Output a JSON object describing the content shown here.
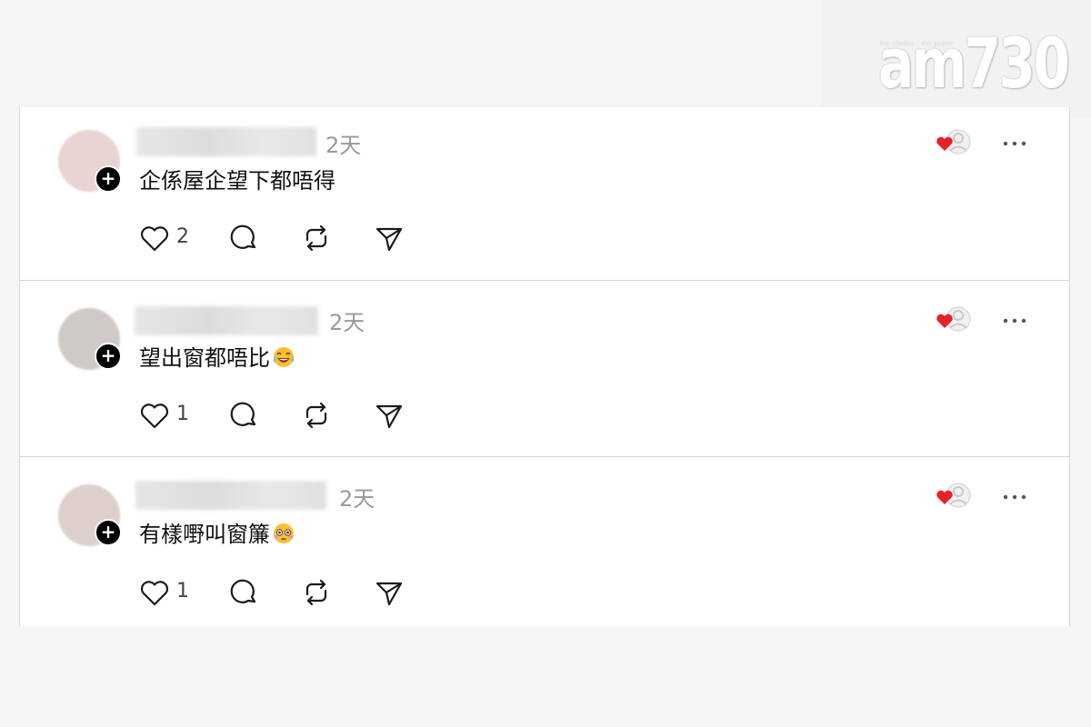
{
  "watermark": {
    "tagline": "my choice · my paper",
    "logo": "am730"
  },
  "posts": [
    {
      "time": "2天",
      "text": "企係屋企望下都唔得",
      "emoji": "",
      "likes": "2",
      "avatar_color": "#e9d3d3"
    },
    {
      "time": "2天",
      "text": "望出窗都唔比",
      "emoji": "laughing-tears-emoji",
      "likes": "1",
      "avatar_color": "#cfcac6"
    },
    {
      "time": "2天",
      "text": "有樣嘢叫窗簾",
      "emoji": "flushed-face-emoji",
      "likes": "1",
      "avatar_color": "#dccfcc"
    }
  ],
  "colors": {
    "heart": "#e8202a",
    "icon_stroke": "#1a1a1a",
    "divider": "#d6d6d6"
  }
}
